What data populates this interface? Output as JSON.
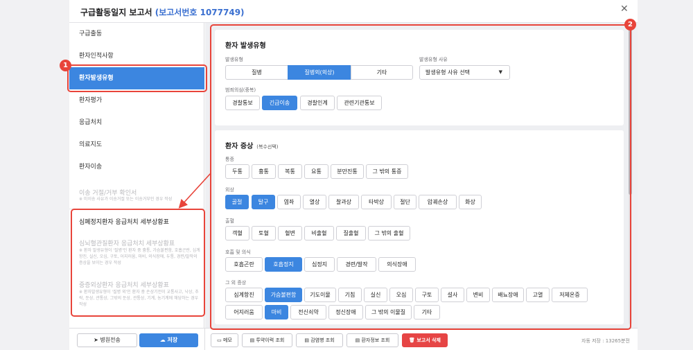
{
  "window": {
    "title": "구급활동일지 보고서",
    "report_number": "(보고서번호 1077749)"
  },
  "sidebar": {
    "items": [
      {
        "label": "구급출동"
      },
      {
        "label": "환자인적사항"
      },
      {
        "label": "환자발생유형"
      },
      {
        "label": "환자평가"
      },
      {
        "label": "응급처치"
      },
      {
        "label": "의료지도"
      },
      {
        "label": "환자이송"
      }
    ],
    "refusal": {
      "label": "이송 거절/거부 확인서",
      "note": "※ 미이송 사유가 이송거절 또는 이송거부인 경우 작성"
    },
    "cardiac_label": "심폐정지환자 응급처치 세부상황표",
    "cardiovascular": {
      "label": "심뇌혈관질환자 응급처치 세부상황표",
      "note": "※ 환자 발생유형이 '질병'인 환자 중 흉통, 가슴불편함, 호흡곤란, 심계항진, 실신, 오심, 구토, 어지러움, 마비, 의식장애, 두통, 경련/발작의 증상을 보이는 경우 작성"
    },
    "trauma": {
      "label": "중증외상환자 응급처치 세부상황표",
      "note": "※ 환자발생유형이 '질병 외'인 환자 중 손상기전이 교통사고, 낙상, 추락, 둔상, 관통상, 그밖의 둔상, 관통상, 기계, 농기계에 해당하는 경우 작성"
    },
    "transfer_button": "병원전송",
    "save_button": "저장"
  },
  "occurrence": {
    "title": "환자 발생유형",
    "type_label": "발생유형",
    "types": [
      "질병",
      "질병외(외상)",
      "기타"
    ],
    "selected_type": "질병외(외상)",
    "reason_label": "발생유형 사유",
    "reason_value": "발생유형 사유 선택",
    "crime_label": "범죄의심(중복)",
    "crime_options": [
      "경찰통보",
      "긴급이송",
      "경찰인계",
      "관련기관통보"
    ],
    "crime_selected": [
      "긴급이송"
    ]
  },
  "symptoms": {
    "title": "환자 증상",
    "hint": "(복수선택)",
    "groups": [
      {
        "label": "통증",
        "options": [
          "두통",
          "흉통",
          "복통",
          "요통",
          "분만진통",
          "그 밖의 통증"
        ],
        "selected": []
      },
      {
        "label": "외상",
        "options": [
          "골절",
          "탈구",
          "염좌",
          "열상",
          "찰과상",
          "타박상",
          "절단",
          "압궤손상",
          "화상"
        ],
        "selected": [
          "골절",
          "탈구"
        ]
      },
      {
        "label": "출혈",
        "options": [
          "객혈",
          "토혈",
          "혈변",
          "비출혈",
          "질출혈",
          "그 밖의 출혈"
        ],
        "selected": []
      },
      {
        "label": "호흡 및 의식",
        "options": [
          "호흡곤란",
          "호흡정지",
          "심정지",
          "경련/발작",
          "의식장애"
        ],
        "selected": [
          "호흡정지"
        ]
      },
      {
        "label": "그 외 증상",
        "options": [
          "심계항진",
          "가슴불편함",
          "기도이물",
          "기침",
          "실신",
          "오심",
          "구토",
          "설사",
          "변비",
          "배뇨장애",
          "고열",
          "저체온증",
          "어지러움",
          "마비",
          "전신쇠약",
          "정신장애",
          "그 밖의 이물질",
          "기타"
        ],
        "selected": [
          "가슴불편함",
          "마비"
        ]
      }
    ]
  },
  "footer": {
    "buttons": [
      "메모",
      "투약이력 조회",
      "감염병 조회",
      "환자정보 조회",
      "보고서 삭제"
    ],
    "autosave": "자동 저장 : 13265분전"
  },
  "annotations": {
    "badge_1": "1",
    "badge_2": "2",
    "highlight_color": "#e8443a"
  },
  "colors": {
    "accent": "#3c86e0",
    "danger": "#e64545"
  }
}
